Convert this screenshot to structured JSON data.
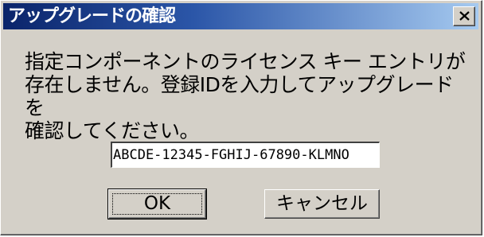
{
  "window": {
    "title": "アップグレードの確認",
    "close_glyph": "×"
  },
  "message": {
    "text": "指定コンポーネントのライセンス キー エントリが\n存在しません。登録IDを入力してアップグレードを\n確認してください。"
  },
  "registration_field": {
    "value": "ABCDE-12345-FGHIJ-67890-KLMNO"
  },
  "buttons": {
    "ok_label": "OK",
    "cancel_label": "キャンセル"
  },
  "colors": {
    "titlebar_start": "#0a246a",
    "titlebar_end": "#a6caf0",
    "dialog_face": "#d4d0c8"
  }
}
